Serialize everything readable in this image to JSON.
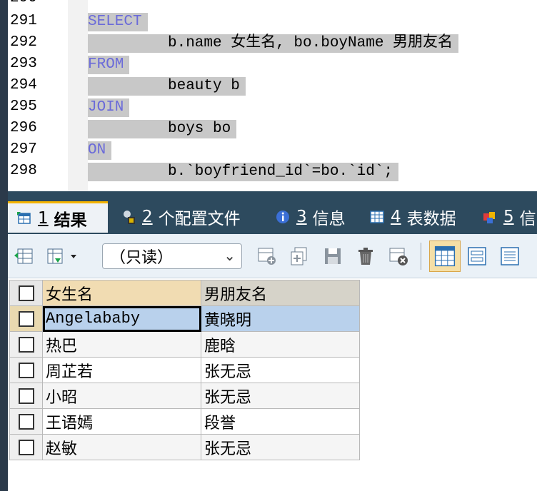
{
  "editor": {
    "partial_top_line": "290",
    "lines": [
      {
        "num": "291",
        "kw": "SELECT",
        "text": ""
      },
      {
        "num": "292",
        "kw": "",
        "text": "b.name 女生名, bo.boyName 男朋友名"
      },
      {
        "num": "293",
        "kw": "FROM",
        "text": ""
      },
      {
        "num": "294",
        "kw": "",
        "text": "beauty b"
      },
      {
        "num": "295",
        "kw": "JOIN",
        "text": ""
      },
      {
        "num": "296",
        "kw": "",
        "text": "boys bo"
      },
      {
        "num": "297",
        "kw": "ON",
        "text": ""
      },
      {
        "num": "298",
        "kw": "",
        "text": "b.`boyfriend_id`=bo.`id`;"
      }
    ]
  },
  "tabs": [
    {
      "num": "1",
      "label": "结果",
      "icon": "result-grid-icon"
    },
    {
      "num": "2",
      "label": "个配置文件",
      "icon": "profile-icon"
    },
    {
      "num": "3",
      "label": "信息",
      "icon": "info-icon"
    },
    {
      "num": "4",
      "label": "表数据",
      "icon": "table-data-icon"
    },
    {
      "num": "5",
      "label": "信",
      "icon": "info-color-icon"
    }
  ],
  "toolbar": {
    "mode_select": "（只读）"
  },
  "grid": {
    "columns": [
      "女生名",
      "男朋友名"
    ],
    "rows": [
      [
        "Angelababy",
        "黄晓明"
      ],
      [
        "热巴",
        "鹿晗"
      ],
      [
        "周芷若",
        "张无忌"
      ],
      [
        "小昭",
        "张无忌"
      ],
      [
        "王语嫣",
        "段誉"
      ],
      [
        "赵敏",
        "张无忌"
      ]
    ]
  },
  "colors": {
    "keyword": "#6b6bd9",
    "selection": "#c8c8c8",
    "tab_bar": "#2d4a5e",
    "row_selected": "#b9d1ec"
  }
}
